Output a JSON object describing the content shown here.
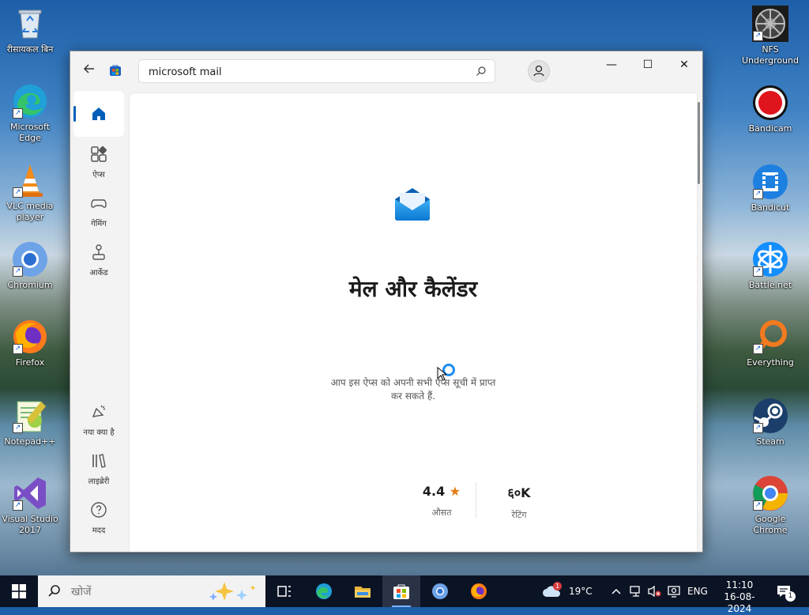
{
  "desktop": {
    "left_icons": [
      {
        "label": "रीसायकल बिन"
      },
      {
        "label": "Microsoft Edge"
      },
      {
        "label": "VLC media player"
      },
      {
        "label": "Chromium"
      },
      {
        "label": "Firefox"
      },
      {
        "label": "Notepad++"
      },
      {
        "label": "Visual Studio 2017"
      }
    ],
    "right_icons": [
      {
        "label": "NFS Underground"
      },
      {
        "label": "Bandicam"
      },
      {
        "label": "Bandicut"
      },
      {
        "label": "Battle.net"
      },
      {
        "label": "Everything"
      },
      {
        "label": "Steam"
      },
      {
        "label": "Google Chrome"
      }
    ]
  },
  "store": {
    "search": {
      "value": "microsoft mail"
    },
    "window_buttons": {
      "minimize": "—",
      "maximize": "☐",
      "close": "✕"
    },
    "nav": [
      {
        "label": ""
      },
      {
        "label": "ऐप्स"
      },
      {
        "label": "गेमिंग"
      },
      {
        "label": "आर्केड"
      },
      {
        "label": "नया क्या है"
      },
      {
        "label": "लाइब्रेरी"
      },
      {
        "label": "मदद"
      }
    ],
    "app": {
      "title": "मेल और कैलेंडर",
      "availability_line1": "आप इस ऐप्स को अपनी सभी ऐप्स सूची में प्राप्त",
      "availability_line2": "कर सकते हैं.",
      "rating_value": "4.4",
      "rating_label": "औसत",
      "ratings_count": "६०K",
      "ratings_label": "रेटिंग"
    },
    "accent_color": "#005fb8"
  },
  "taskbar": {
    "search_placeholder": "खोजें",
    "weather_temp": "19°C",
    "weather_badge": "1",
    "language": "ENG",
    "time": "11:10",
    "date": "16-08-2024",
    "notification_count": "1"
  }
}
